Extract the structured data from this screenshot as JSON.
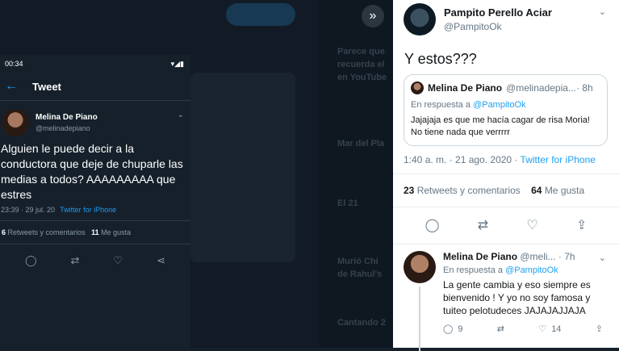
{
  "phone": {
    "status_time": "00:34",
    "status_icons": "▾◢▮",
    "header_title": "Tweet",
    "author_name": "Melina De Piano",
    "author_handle": "@melinadepiano",
    "tweet_text": "Alguien le puede decir a la conductora que deje de chuparle las medias a todos? AAAAAAAAA que estres",
    "time": "23:39 · 29 jul. 20",
    "via": "Twitter for iPhone",
    "retweets_count": "6",
    "retweets_label": "Retweets y comentarios",
    "likes_count": "11",
    "likes_label": "Me gusta"
  },
  "background_fragments": [
    "Parece que",
    "recuerda el",
    "en YouTube",
    "Mar del Pla",
    "El 21",
    "Murió Chi",
    "de Rahul's",
    "Cantando 2"
  ],
  "main_tweet": {
    "author_name": "Pampito Perello Aciar",
    "author_handle": "@PampitoOk",
    "text": "Y estos???",
    "quote": {
      "author_name": "Melina De Piano",
      "author_handle": "@melinadepia...",
      "time": "· 8h",
      "reply_prefix": "En respuesta a",
      "reply_to": "@PampitoOk",
      "text": "Jajajaja es que me hacía cagar de risa Moria! No tiene nada que verrrrr"
    },
    "time": "1:40 a. m. · 21 ago. 2020 ·",
    "via": "Twitter for iPhone",
    "retweets_count": "23",
    "retweets_label": "Retweets y comentarios",
    "likes_count": "64",
    "likes_label": "Me gusta"
  },
  "reply": {
    "author_name": "Melina De Piano",
    "author_handle": "@meli...",
    "time": "· 7h",
    "reply_prefix": "En respuesta a",
    "reply_to": "@PampitoOk",
    "text": "La gente cambia y eso siempre es bienvenido ! Y yo no soy famosa y tuiteo pelotudeces JAJAJAJJAJA",
    "reply_count": "9",
    "like_count": "14"
  },
  "colors": {
    "accent": "#1da1f2",
    "dark_bg": "#15202b",
    "light_bg": "#ffffff"
  }
}
